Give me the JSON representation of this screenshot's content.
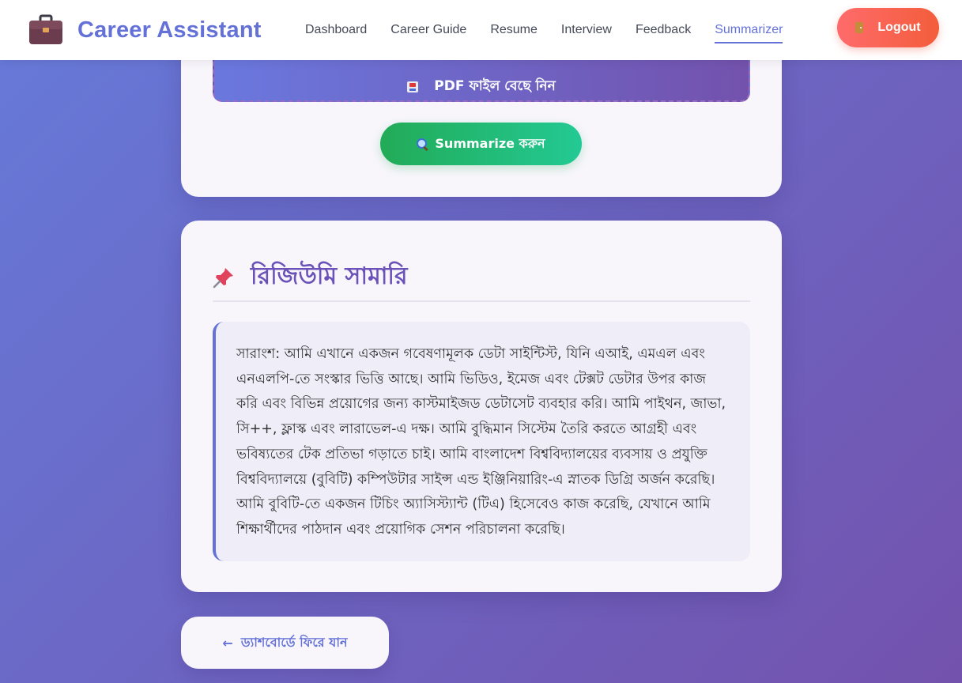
{
  "brand": {
    "title": "Career Assistant",
    "icon": "briefcase-icon"
  },
  "nav": {
    "items": [
      {
        "label": "Dashboard",
        "active": false
      },
      {
        "label": "Career Guide",
        "active": false
      },
      {
        "label": "Resume",
        "active": false
      },
      {
        "label": "Interview",
        "active": false
      },
      {
        "label": "Feedback",
        "active": false
      },
      {
        "label": "Summarizer",
        "active": true
      }
    ],
    "logout_label": "Logout",
    "logout_icon": "door-icon"
  },
  "upload": {
    "file_label": "PDF ফাইল বেছে নিন",
    "file_icon": "inbox-tray-icon",
    "summarize_label": "Summarize করুন",
    "summarize_icon": "magnifier-icon"
  },
  "summary": {
    "title": "রিজিউমি সামারি",
    "title_icon": "pushpin-icon",
    "text": "সারাংশ: আমি এখানে একজন গবেষণামূলক ডেটা সাইন্টিস্ট, যিনি এআই, এমএল এবং এনএলপি-তে সংস্কার ভিত্তি আছে। আমি ভিডিও, ইমেজ এবং টেক্সট ডেটার উপর কাজ করি এবং বিভিন্ন প্রয়োগের জন্য কাস্টমাইজড ডেটাসেট ব্যবহার করি। আমি পাইথন, জাভা, সি++, ফ্লাস্ক এবং লারাভেল-এ দক্ষ। আমি বুদ্ধিমান সিস্টেম তৈরি করতে আগ্রহী এবং ভবিষ্যতের টেক প্রতিভা গড়াতে চাই। আমি বাংলাদেশ বিশ্ববিদ্যালয়ের ব্যবসায় ও প্রযুক্তি বিশ্ববিদ্যালয়ে (বুবিটি) কম্পিউটার সাইন্স এন্ড ইঞ্জিনিয়ারিং-এ স্নাতক ডিগ্রি অর্জন করেছি। আমি বুবিটি-তে একজন টিচিং অ্যাসিস্ট্যান্ট (টিএ) হিসেবেও কাজ করেছি, যেখানে আমি শিক্ষার্থীদের পাঠদান এবং প্রয়োগিক সেশন পরিচালনা করেছি।"
  },
  "back": {
    "label": "ড্যাশবোর্ডে ফিরে যান",
    "arrow": "←"
  },
  "colors": {
    "accent": "#6472d8",
    "logout": "#ff6b6b",
    "summarize": "#22ab57"
  }
}
